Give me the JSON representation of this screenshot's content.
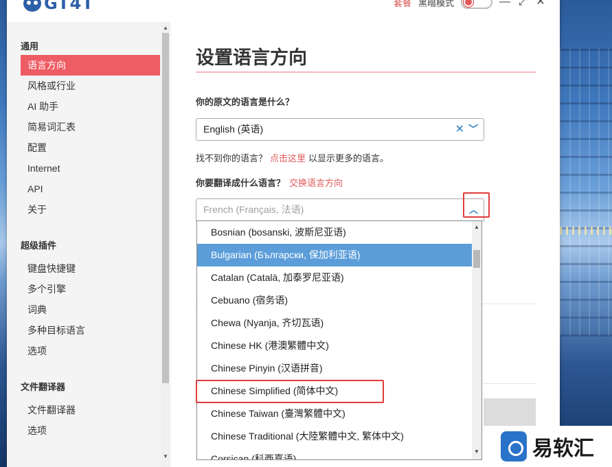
{
  "app": {
    "logo_text": "GT4T"
  },
  "titlebar": {
    "plan_label": "套餐",
    "dark_mode_label": "黑暗模式",
    "minimize": "—",
    "maximize": "⤢",
    "close": "✕"
  },
  "sidebar": {
    "sections": [
      {
        "title": "通用",
        "items": [
          {
            "label": "语言方向",
            "active": true
          },
          {
            "label": "风格或行业"
          },
          {
            "label": "AI 助手"
          },
          {
            "label": "简易词汇表"
          },
          {
            "label": "配置"
          },
          {
            "label": "Internet"
          },
          {
            "label": "API"
          },
          {
            "label": "关于"
          }
        ]
      },
      {
        "title": "超级插件",
        "items": [
          {
            "label": "键盘快捷键"
          },
          {
            "label": "多个引擎"
          },
          {
            "label": "词典"
          },
          {
            "label": "多种目标语言"
          },
          {
            "label": "选项"
          }
        ]
      },
      {
        "title": "文件翻译器",
        "items": [
          {
            "label": "文件翻译器"
          },
          {
            "label": "选项"
          }
        ]
      }
    ]
  },
  "main": {
    "page_title": "设置语言方向",
    "source_question": "你的原文的语言是什么？",
    "source_value": "English (英语)",
    "hint_prefix": "找不到你的语言？",
    "hint_link": "点击这里",
    "hint_suffix": "以显示更多的语言。",
    "target_question": "你要翻译成什么语言？",
    "swap_link": "交换语言方向",
    "target_placeholder": "French (Français, 法语)",
    "dropdown_options": [
      {
        "label": "Bosnian (bosanski, 波斯尼亚语)"
      },
      {
        "label": "Bulgarian (Български, 保加利亚语)",
        "highlighted": true
      },
      {
        "label": "Catalan (Català, 加泰罗尼亚语)"
      },
      {
        "label": "Cebuano (宿务语)"
      },
      {
        "label": "Chewa (Nyanja, 齐切瓦语)"
      },
      {
        "label": "Chinese HK (港澳繁體中文)"
      },
      {
        "label": "Chinese Pinyin (汉语拼音)"
      },
      {
        "label": "Chinese Simplified (简体中文)"
      },
      {
        "label": "Chinese Taiwan (臺灣繁體中文)"
      },
      {
        "label": "Chinese Traditional (大陸繁體中文, 繁体中文)"
      },
      {
        "label": "Corsican (科西嘉语)"
      }
    ]
  },
  "watermark": {
    "text": "易软汇"
  },
  "colors": {
    "accent": "#ee5c64",
    "highlight": "#5b9dd9",
    "link": "#e05a5a",
    "icon": "#2b7ec2"
  }
}
